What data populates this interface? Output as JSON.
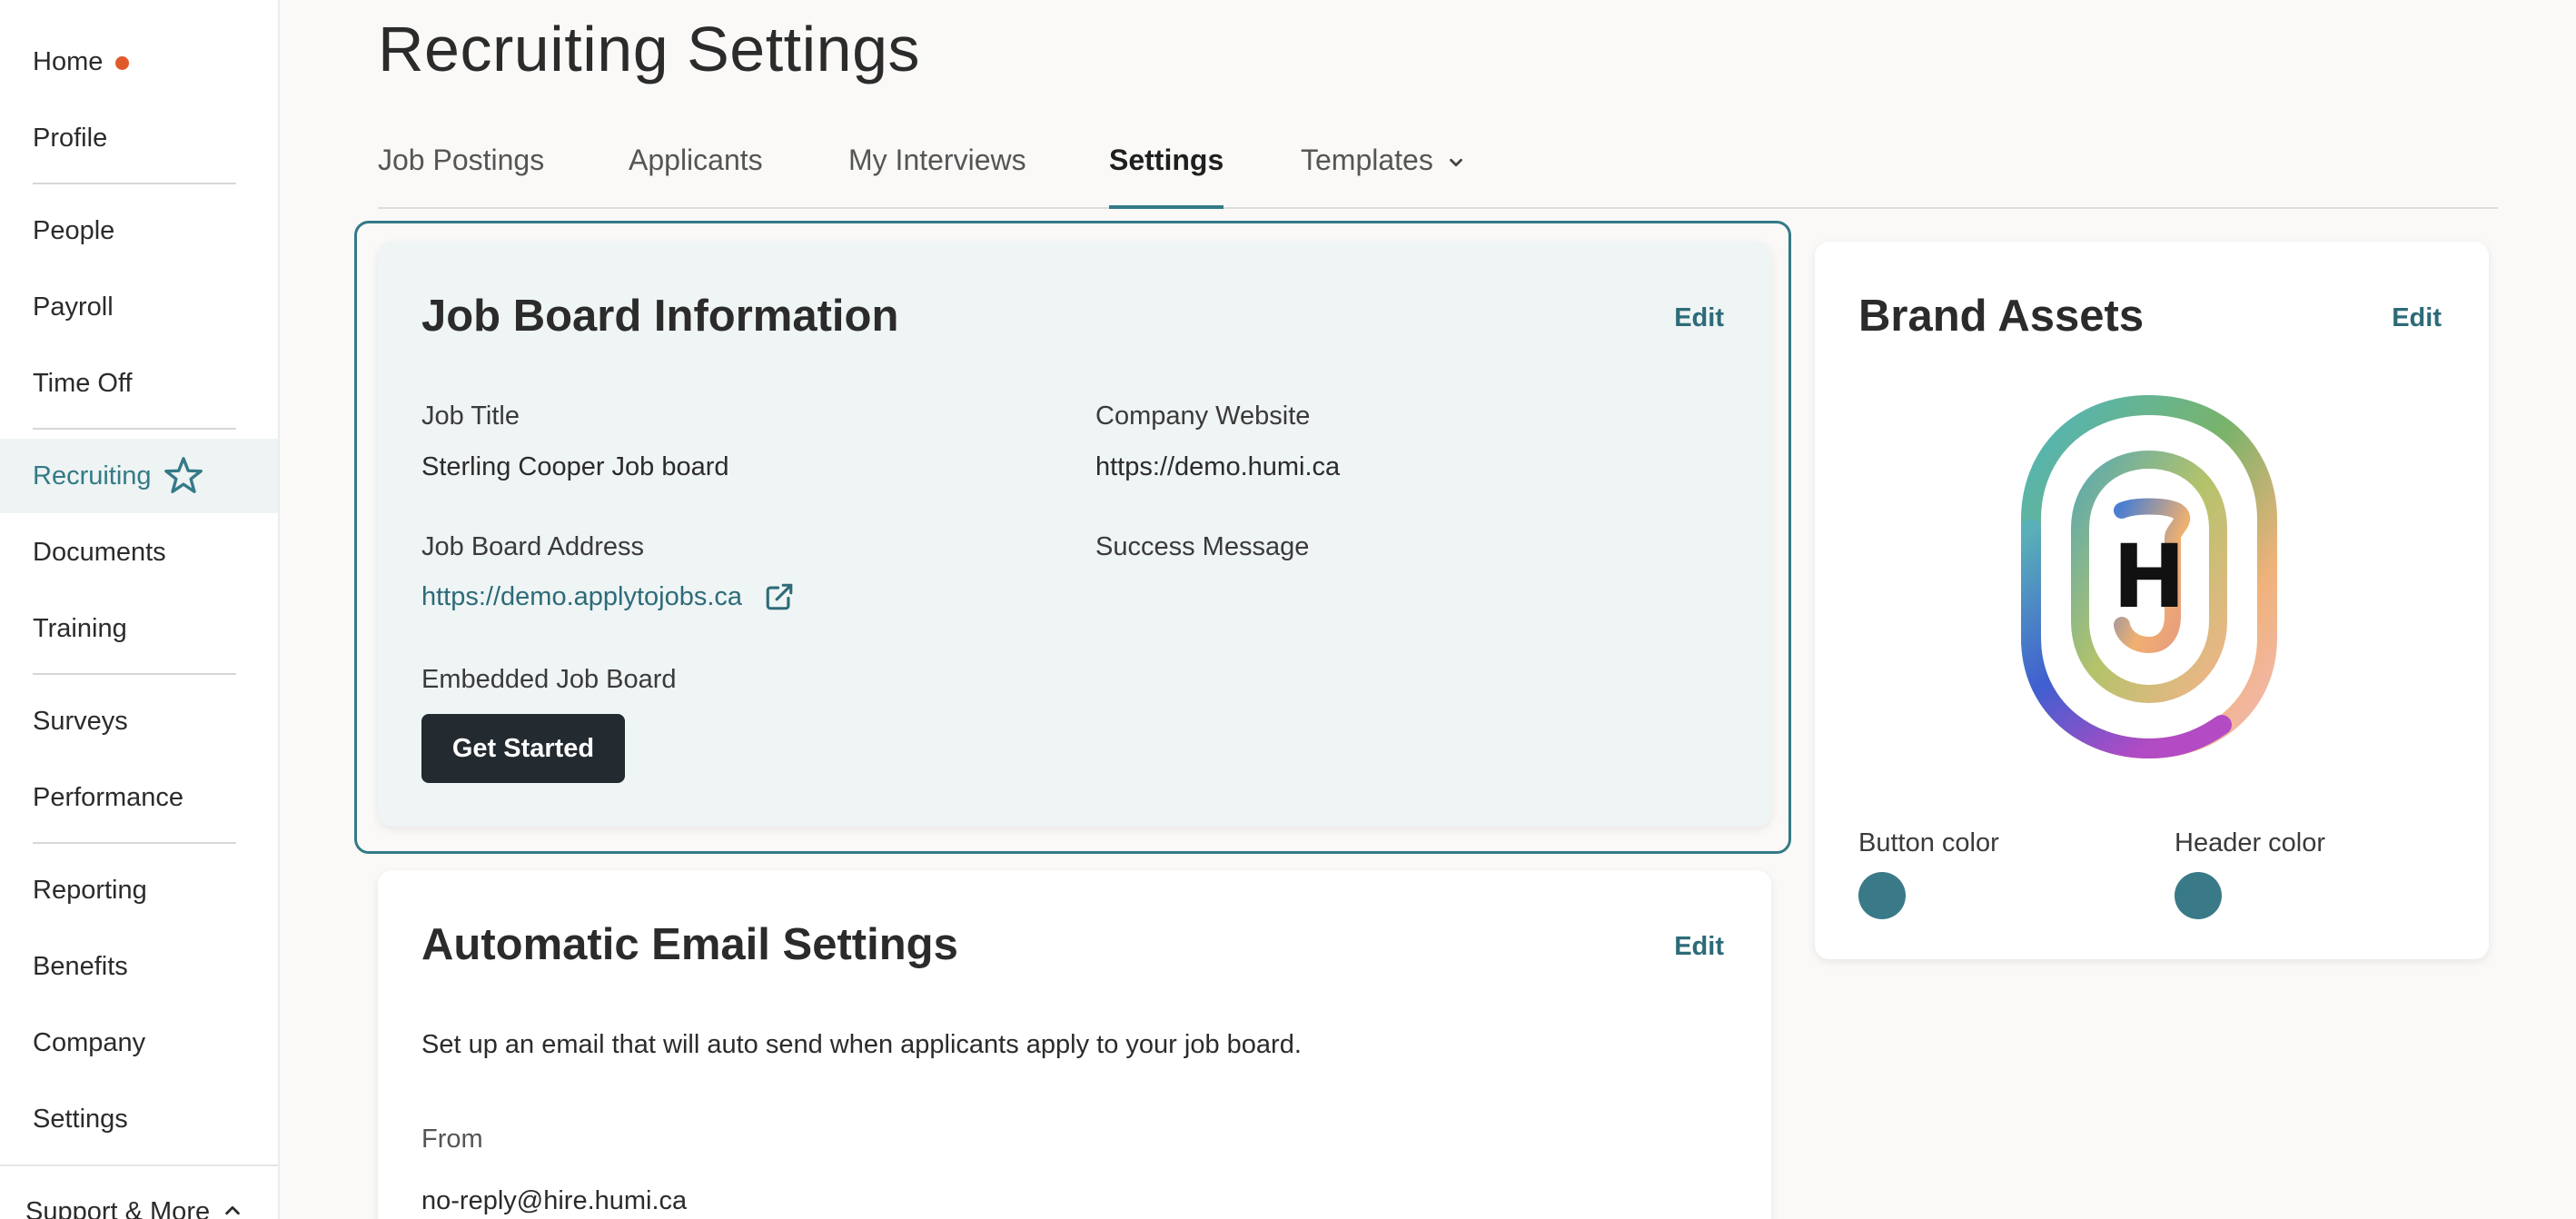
{
  "sidebar": {
    "items": [
      {
        "label": "Home"
      },
      {
        "label": "Profile"
      },
      {
        "label": "People"
      },
      {
        "label": "Payroll"
      },
      {
        "label": "Time Off"
      },
      {
        "label": "Recruiting"
      },
      {
        "label": "Documents"
      },
      {
        "label": "Training"
      },
      {
        "label": "Surveys"
      },
      {
        "label": "Performance"
      },
      {
        "label": "Reporting"
      },
      {
        "label": "Benefits"
      },
      {
        "label": "Company"
      },
      {
        "label": "Settings"
      }
    ],
    "support_label": "Support & More",
    "active_item": "Recruiting",
    "notification_color": "#e05a2b"
  },
  "header": {
    "title": "Recruiting Settings",
    "tabs": [
      {
        "label": "Job Postings"
      },
      {
        "label": "Applicants"
      },
      {
        "label": "My Interviews"
      },
      {
        "label": "Settings"
      },
      {
        "label": "Templates"
      }
    ],
    "active_tab": "Settings"
  },
  "job_board": {
    "title": "Job Board Information",
    "edit_label": "Edit",
    "job_title_label": "Job Title",
    "job_title_value": "Sterling Cooper Job board",
    "company_website_label": "Company Website",
    "company_website_value": "https://demo.humi.ca",
    "address_label": "Job Board Address",
    "address_value": "https://demo.applytojobs.ca",
    "success_message_label": "Success Message",
    "embedded_label": "Embedded Job Board",
    "get_started_label": "Get Started"
  },
  "brand_assets": {
    "title": "Brand Assets",
    "edit_label": "Edit",
    "logo_letter": "H",
    "button_color_label": "Button color",
    "button_color": "#3a7a88",
    "header_color_label": "Header color",
    "header_color": "#3a7a88"
  },
  "email_settings": {
    "title": "Automatic Email Settings",
    "edit_label": "Edit",
    "description": "Set up an email that will auto send when applicants apply to your job board.",
    "from_label": "From",
    "from_value": "no-reply@hire.humi.ca"
  },
  "colors": {
    "accent": "#347a87",
    "link": "#2d6b78",
    "dark_button": "#232a30"
  }
}
